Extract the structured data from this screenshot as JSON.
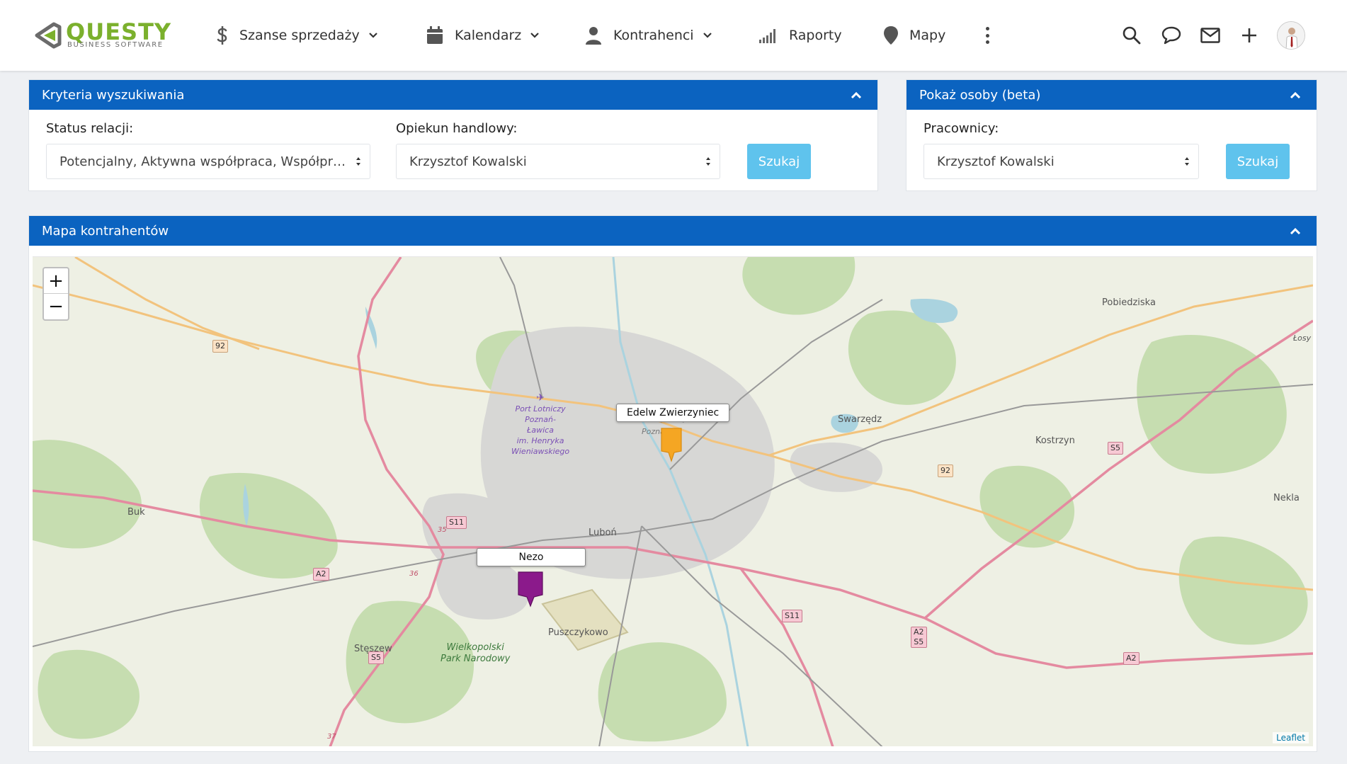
{
  "logo": {
    "name": "QUESTY",
    "subtitle": "BUSINESS SOFTWARE"
  },
  "nav": {
    "items": [
      {
        "label": "Szanse sprzedaży",
        "icon": "dollar-icon",
        "dropdown": true
      },
      {
        "label": "Kalendarz",
        "icon": "calendar-icon",
        "dropdown": true
      },
      {
        "label": "Kontrahenci",
        "icon": "user-icon",
        "dropdown": true
      },
      {
        "label": "Raporty",
        "icon": "signal-bars-icon",
        "dropdown": false
      },
      {
        "label": "Mapy",
        "icon": "map-pin-icon",
        "dropdown": false
      }
    ],
    "tools": [
      "search-icon",
      "chat-icon",
      "mail-icon",
      "plus-icon",
      "avatar"
    ]
  },
  "criteria": {
    "title": "Kryteria wyszukiwania",
    "status_label": "Status relacji:",
    "status_value": "Potencjalny, Aktywna współpraca, Współprac...",
    "owner_label": "Opiekun handlowy:",
    "owner_value": "Krzysztof Kowalski",
    "search_button": "Szukaj"
  },
  "people": {
    "title": "Pokaż osoby (beta)",
    "employees_label": "Pracownicy:",
    "employees_value": "Krzysztof Kowalski",
    "search_button": "Szukaj"
  },
  "map": {
    "title": "Mapa kontrahentów",
    "zoom_in": "+",
    "zoom_out": "−",
    "attribution": "Leaflet",
    "markers": [
      {
        "label": "Edelw Zwierzyniec",
        "color": "#f5a623"
      },
      {
        "label": "Nezo",
        "color": "#8b1a8b"
      }
    ],
    "places": {
      "poznan": "Poznań",
      "poznan_small": "Poznań",
      "swarzedz": "Swarzędz",
      "kostrzyn": "Kostrzyn",
      "pobiedziska": "Pobiedziska",
      "nekla": "Nekla",
      "buk": "Buk",
      "lubon": "Luboń",
      "puszczykowo": "Puszczykowo",
      "steszew": "Stęszew",
      "losy": "Łosy"
    },
    "airport_lines": [
      "Port Lotniczy",
      "Poznań-",
      "Ławica",
      "im. Henryka",
      "Wieniawskiego"
    ],
    "park_lines": [
      "Wielkopolski",
      "Park Narodowy"
    ],
    "roads": {
      "r92a": "92",
      "r92b": "92",
      "s11a": "S11",
      "s11b": "S11",
      "a2a": "A2",
      "a2b": "A2",
      "a2s5_a": "A2",
      "a2s5_b": "S5",
      "s5a": "S5",
      "s5b": "S5",
      "n35": "35",
      "n36": "36",
      "n37": "37"
    }
  },
  "colors": {
    "header_blue": "#0b63c0",
    "button_blue": "#5fc3ed",
    "logo_green": "#7bb02d"
  }
}
